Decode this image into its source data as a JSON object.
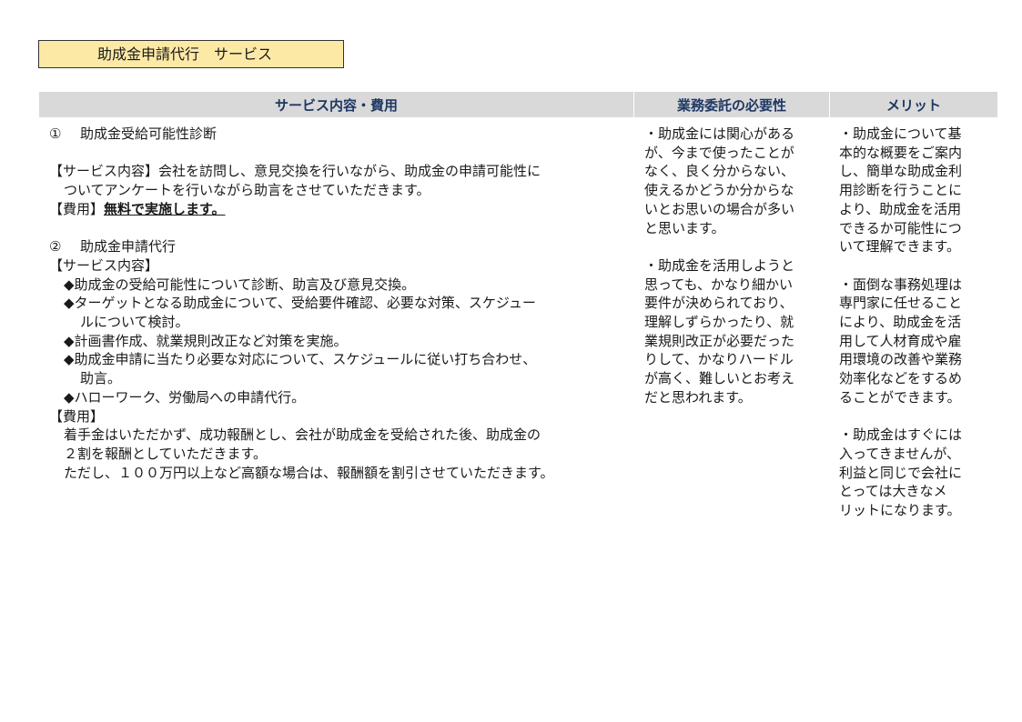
{
  "title": "助成金申請代行　サービス",
  "headers": {
    "content_cost": "サービス内容・費用",
    "necessity": "業務委託の必要性",
    "merit": "メリット"
  },
  "service1": {
    "number": "①",
    "name": "助成金受給可能性診断",
    "content_line1": "【サービス内容】会社を訪問し、意見交換を行いながら、助成金の申請可能性に",
    "content_line2": "ついてアンケートを行いながら助言をさせていただきます。",
    "fee_label": "【費用】",
    "fee_value": "無料で実施します。"
  },
  "service2": {
    "number": "②",
    "name": "助成金申請代行",
    "content_label": "【サービス内容】",
    "items": [
      "◆助成金の受給可能性について診断、助言及び意見交換。",
      "◆ターゲットとなる助成金について、受給要件確認、必要な対策、スケジュー",
      "ルについて検討。",
      "◆計画書作成、就業規則改正など対策を実施。",
      "◆助成金申請に当たり必要な対応について、スケジュールに従い打ち合わせ、",
      "助言。",
      "◆ハローワーク、労働局への申請代行。"
    ],
    "fee_label": "【費用】",
    "fee_lines": [
      "着手金はいただかず、成功報酬とし、会社が助成金を受給された後、助成金の",
      "２割を報酬としていただきます。",
      "ただし、１００万円以上など高額な場合は、報酬額を割引させていただきます。"
    ]
  },
  "necessity_lines": [
    "・助成金には関心がある",
    "が、今まで使ったことが",
    "なく、良く分からない、",
    "使えるかどうか分からな",
    "いとお思いの場合が多い",
    "と思います。",
    "",
    "・助成金を活用しようと",
    "思っても、かなり細かい",
    "要件が決められており、",
    "理解しずらかったり、就",
    "業規則改正が必要だった",
    "りして、かなりハードル",
    "が高く、難しいとお考え",
    "だと思われます。"
  ],
  "merit_lines": [
    "・助成金について基",
    "本的な概要をご案内",
    "し、簡単な助成金利",
    "用診断を行うことに",
    "より、助成金を活用",
    "できるか可能性につ",
    "いて理解できます。",
    "",
    "・面倒な事務処理は",
    "専門家に任せること",
    "により、助成金を活",
    "用して人材育成や雇",
    "用環境の改善や業務",
    "効率化などをするめ",
    "ることができます。",
    "",
    "・助成金はすぐには",
    "入ってきませんが、",
    "利益と同じで会社に",
    "とっては大きなメ",
    "リットになります。"
  ]
}
